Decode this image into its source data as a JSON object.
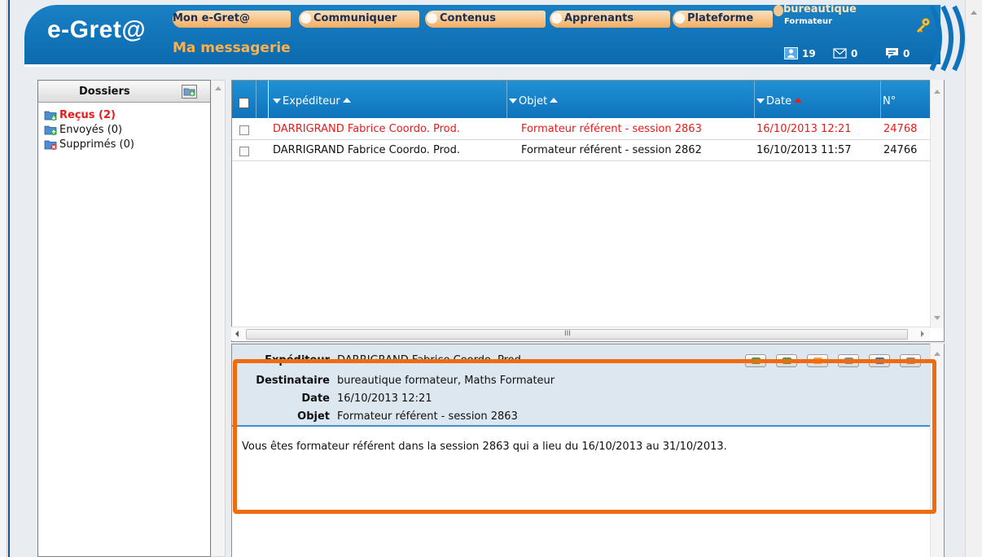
{
  "header": {
    "logo": "e-Gret@",
    "page_title": "Ma messagerie",
    "nav_tabs": [
      "Mon e-Gret@",
      "Communiquer",
      "Contenus",
      "Apprenants",
      "Plateforme"
    ],
    "user": {
      "name": "bureautique",
      "role": "Formateur"
    },
    "counters": [
      {
        "icon": "contacts-icon",
        "value": "19"
      },
      {
        "icon": "mail-icon",
        "value": "0"
      },
      {
        "icon": "chat-icon",
        "value": "0"
      }
    ],
    "colors": {
      "header_blue": "#0f73bb",
      "tab_orange": "#f3ad62",
      "title_orange": "#ffb04a"
    }
  },
  "folders": {
    "title": "Dossiers",
    "items": [
      {
        "label": "Reçus (2)",
        "icon": "inbox-folder-icon",
        "active": true
      },
      {
        "label": "Envoyés (0)",
        "icon": "sent-folder-icon",
        "active": false
      },
      {
        "label": "Supprimés (0)",
        "icon": "deleted-folder-icon",
        "active": false
      }
    ]
  },
  "messages": {
    "columns": [
      "Expéditeur",
      "Objet",
      "Date",
      "N°"
    ],
    "rows": [
      {
        "sender": "DARRIGRAND Fabrice Coordo. Prod.",
        "subject": "Formateur référent - session 2863",
        "date": "16/10/2013 12:21",
        "num": "24768",
        "unread": true
      },
      {
        "sender": "DARRIGRAND Fabrice Coordo. Prod.",
        "subject": "Formateur référent - session 2862",
        "date": "16/10/2013 11:57",
        "num": "24766",
        "unread": false
      }
    ],
    "unread_color": "#e41c1c"
  },
  "preview": {
    "fields": {
      "sender_label": "Expéditeur",
      "sender": "DARRIGRAND Fabrice Coordo. Prod.",
      "recipient_label": "Destinataire",
      "recipient": "bureautique formateur, Maths Formateur",
      "date_label": "Date",
      "date": "16/10/2013 12:21",
      "subject_label": "Objet",
      "subject": "Formateur référent - session 2863"
    },
    "body": "Vous êtes formateur référent dans la session 2863 qui a lieu du 16/10/2013 au 31/10/2013.",
    "highlight_color": "#ef6b0d"
  }
}
